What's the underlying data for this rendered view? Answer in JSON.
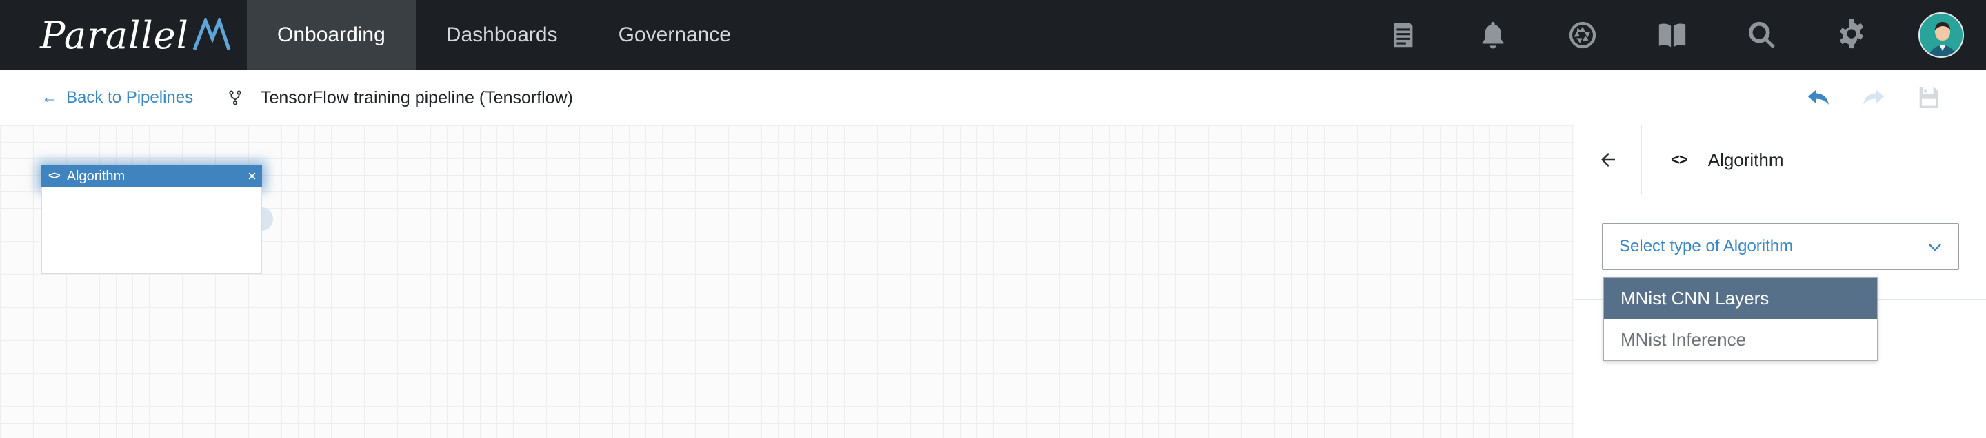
{
  "brand": {
    "name": "Parallel",
    "mark": "M"
  },
  "nav": {
    "tabs": [
      {
        "label": "Onboarding",
        "active": true
      },
      {
        "label": "Dashboards",
        "active": false
      },
      {
        "label": "Governance",
        "active": false
      }
    ],
    "icons": [
      "docs-icon",
      "bell-icon",
      "aperture-icon",
      "book-icon",
      "search-icon",
      "gear-icon",
      "avatar"
    ]
  },
  "subbar": {
    "back_label": "Back to Pipelines",
    "pipeline_title": "TensorFlow training pipeline (Tensorflow)",
    "actions": [
      "undo-icon",
      "redo-icon",
      "save-icon"
    ]
  },
  "canvas": {
    "node": {
      "title": "Algorithm",
      "icon": "code-icon",
      "close": "×"
    }
  },
  "panel": {
    "title": "Algorithm",
    "select": {
      "placeholder": "Select type of Algorithm"
    },
    "options": [
      {
        "label": "MNist CNN Layers",
        "selected": true
      },
      {
        "label": "MNist Inference",
        "selected": false
      }
    ]
  },
  "colors": {
    "navbar": "#1c2024",
    "accent": "#3a87c2",
    "node_header": "#3f84bf",
    "option_selected": "#56708a"
  }
}
